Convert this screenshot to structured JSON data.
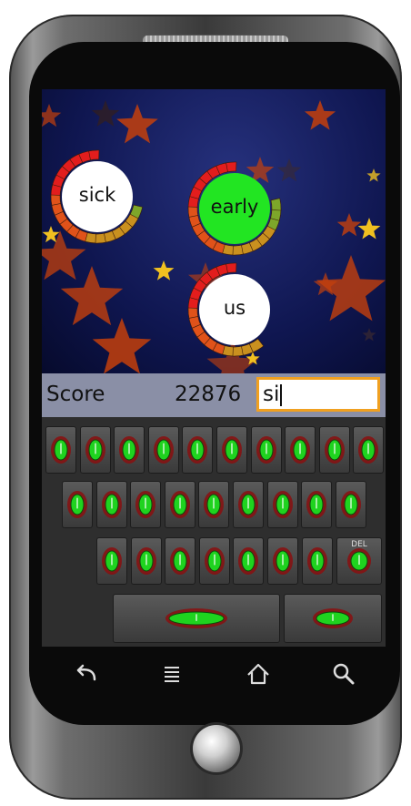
{
  "game": {
    "words": [
      {
        "text": "sick",
        "fill": "#ffffff",
        "timer": 0.72
      },
      {
        "text": "early",
        "fill": "#22e522",
        "timer": 0.8
      },
      {
        "text": "us",
        "fill": "#ffffff",
        "timer": 0.62
      }
    ],
    "score_label": "Score",
    "score_value": "22876",
    "typed_text": "si"
  },
  "keyboard": {
    "delete_label": "DEL"
  },
  "nav": {
    "icons": [
      "back-icon",
      "menu-icon",
      "home-icon",
      "search-icon"
    ]
  },
  "colors": {
    "score_bar": "#8a8fa6",
    "input_border": "#f0a020",
    "star_orange": "#c4400c",
    "star_yellow": "#f0c020"
  }
}
